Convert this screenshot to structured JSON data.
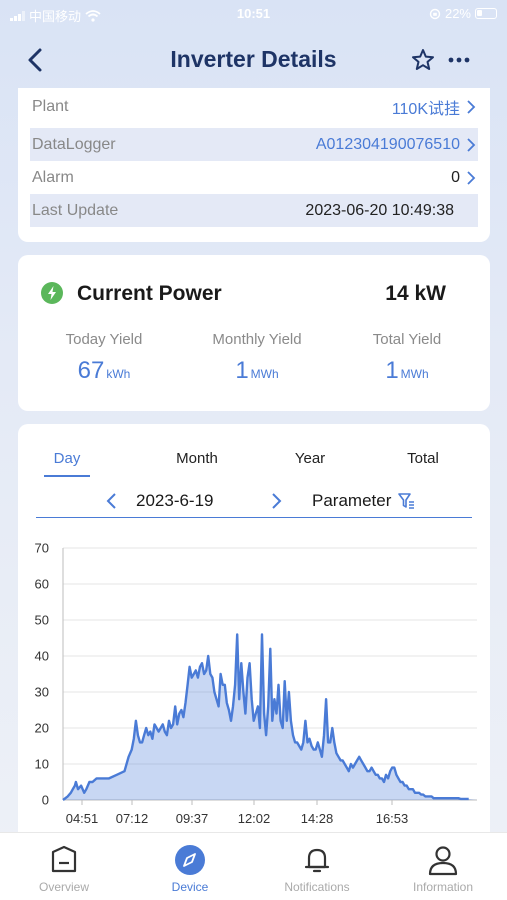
{
  "status_bar": {
    "carrier": "中国移动",
    "time": "10:51",
    "battery": "22%"
  },
  "header": {
    "title": "Inverter Details"
  },
  "info": {
    "rows": [
      {
        "label": "Plant",
        "value": "110K试挂"
      },
      {
        "label": "DataLogger",
        "value": "A012304190076510"
      },
      {
        "label": "Alarm",
        "value": "0"
      },
      {
        "label": "Last Update",
        "value": "2023-06-20 10:49:38"
      }
    ]
  },
  "power": {
    "title": "Current Power",
    "value": "14 kW",
    "yields": [
      {
        "label": "Today Yield",
        "value": "67",
        "unit": "kWh"
      },
      {
        "label": "Monthly Yield",
        "value": "1",
        "unit": "MWh"
      },
      {
        "label": "Total Yield",
        "value": "1",
        "unit": "MWh"
      }
    ]
  },
  "chart_tabs": [
    "Day",
    "Month",
    "Year",
    "Total"
  ],
  "active_chart_tab": "Day",
  "date": "2023-6-19",
  "parameter_label": "Parameter",
  "accent_color": "#4a7bd6",
  "chart_data": {
    "type": "area",
    "title": "",
    "xlabel": "",
    "ylabel": "",
    "ylim": [
      0,
      70
    ],
    "yticks": [
      "0",
      "10",
      "20",
      "30",
      "40",
      "50",
      "60",
      "70"
    ],
    "xticks": [
      "04:51",
      "07:12",
      "09:37",
      "12:02",
      "14:28",
      "16:53"
    ],
    "grid": true,
    "series": [
      {
        "x_minutes": [
          291,
          300,
          306,
          310,
          314,
          316,
          320,
          326,
          332,
          336,
          342,
          348,
          356,
          366,
          380,
          395,
          410,
          418,
          424,
          428,
          432,
          436,
          440,
          444,
          448,
          452,
          456,
          460,
          464,
          468,
          472,
          476,
          480,
          484,
          488,
          492,
          496,
          500,
          504,
          508,
          512,
          516,
          520,
          524,
          528,
          532,
          536,
          540,
          544,
          548,
          552,
          556,
          560,
          564,
          568,
          572,
          576,
          580,
          584,
          588,
          592,
          596,
          600,
          604,
          608,
          612,
          616,
          620,
          624,
          628,
          632,
          636,
          640,
          644,
          648,
          652,
          656,
          660,
          664,
          668,
          672,
          676,
          680,
          684,
          688,
          692,
          696,
          700,
          704,
          708,
          712,
          716,
          720,
          724,
          728,
          732,
          736,
          740,
          744,
          748,
          752,
          756,
          760,
          764,
          768,
          772,
          776,
          780,
          784,
          788,
          792,
          796,
          800,
          804,
          808,
          812,
          816,
          820,
          824,
          828,
          832,
          836,
          840,
          844,
          848,
          852,
          856,
          860,
          864,
          868,
          872,
          876,
          880,
          884,
          888,
          892,
          896,
          900,
          904,
          908,
          912,
          916,
          920,
          924,
          928,
          932,
          936,
          940,
          944,
          948,
          952,
          956,
          960,
          964,
          968,
          972,
          976,
          980,
          984,
          988,
          992,
          996,
          1000,
          1004,
          1008,
          1012,
          1016,
          1020,
          1024,
          1028,
          1032,
          1036,
          1040,
          1044,
          1048,
          1052,
          1056,
          1060,
          1064,
          1068,
          1072,
          1076,
          1080,
          1084,
          1088,
          1092
        ],
        "values": [
          0,
          1,
          2,
          3,
          4,
          5,
          3,
          4,
          2,
          3,
          5,
          5,
          6,
          6,
          6,
          7,
          8,
          12,
          14,
          17,
          22,
          18,
          16,
          16,
          18,
          20,
          18,
          19,
          17,
          21,
          20,
          19,
          20,
          21,
          19,
          18,
          22,
          20,
          21,
          26,
          21,
          24,
          25,
          23,
          27,
          32,
          37,
          34,
          35,
          36,
          34,
          37,
          38,
          35,
          36,
          40,
          35,
          34,
          30,
          28,
          26,
          35,
          32,
          32,
          27,
          25,
          22,
          26,
          32,
          46,
          28,
          38,
          30,
          24,
          34,
          38,
          28,
          22,
          24,
          26,
          20,
          46,
          24,
          18,
          26,
          42,
          22,
          28,
          24,
          32,
          22,
          20,
          33,
          22,
          30,
          22,
          18,
          16,
          16,
          15,
          14,
          16,
          22,
          16,
          17,
          15,
          14,
          14,
          16,
          14,
          12,
          18,
          28,
          16,
          16,
          20,
          16,
          13,
          12,
          11,
          11,
          10,
          9,
          8,
          10,
          9,
          10,
          11,
          12,
          11,
          10,
          9,
          8,
          8,
          9,
          8,
          7,
          7,
          6,
          6,
          5,
          7,
          6,
          8,
          9,
          9,
          7,
          6,
          5,
          5,
          4,
          4,
          3,
          3,
          3,
          2,
          2,
          2,
          1.5,
          1.5,
          1,
          1,
          1,
          1,
          0.5,
          0.5,
          0.5,
          0.5,
          0.5,
          0.5,
          0.5,
          0.5,
          0.5,
          0.5,
          0.5,
          0.5,
          0.5,
          0.3,
          0.3,
          0.3,
          0.3,
          0.3
        ]
      }
    ]
  },
  "bottom_tabs": [
    {
      "label": "Overview",
      "icon": "overview-icon"
    },
    {
      "label": "Device",
      "icon": "compass-icon"
    },
    {
      "label": "Notifications",
      "icon": "bell-icon"
    },
    {
      "label": "Information",
      "icon": "user-icon"
    }
  ]
}
